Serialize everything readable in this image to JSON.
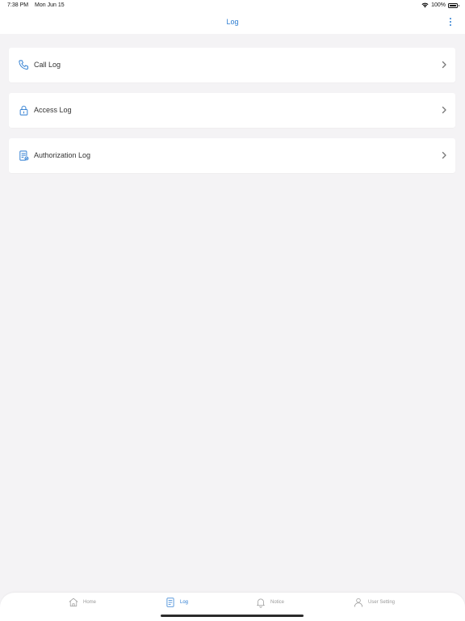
{
  "status_bar": {
    "time": "7:38 PM",
    "date": "Mon Jun 15",
    "battery": "100%"
  },
  "header": {
    "title": "Log",
    "more_icon": "more-vertical-icon",
    "accent_color": "#2a7bd1"
  },
  "items": [
    {
      "label": "Call Log",
      "icon": "phone-icon"
    },
    {
      "label": "Access Log",
      "icon": "lock-icon"
    },
    {
      "label": "Authorization Log",
      "icon": "document-check-icon"
    }
  ],
  "tab_bar": {
    "tabs": [
      {
        "label": "Home",
        "icon": "home-icon",
        "active": false
      },
      {
        "label": "Log",
        "icon": "log-icon",
        "active": true
      },
      {
        "label": "Notice",
        "icon": "bell-icon",
        "active": false
      },
      {
        "label": "User Setting",
        "icon": "user-icon",
        "active": false
      }
    ]
  }
}
